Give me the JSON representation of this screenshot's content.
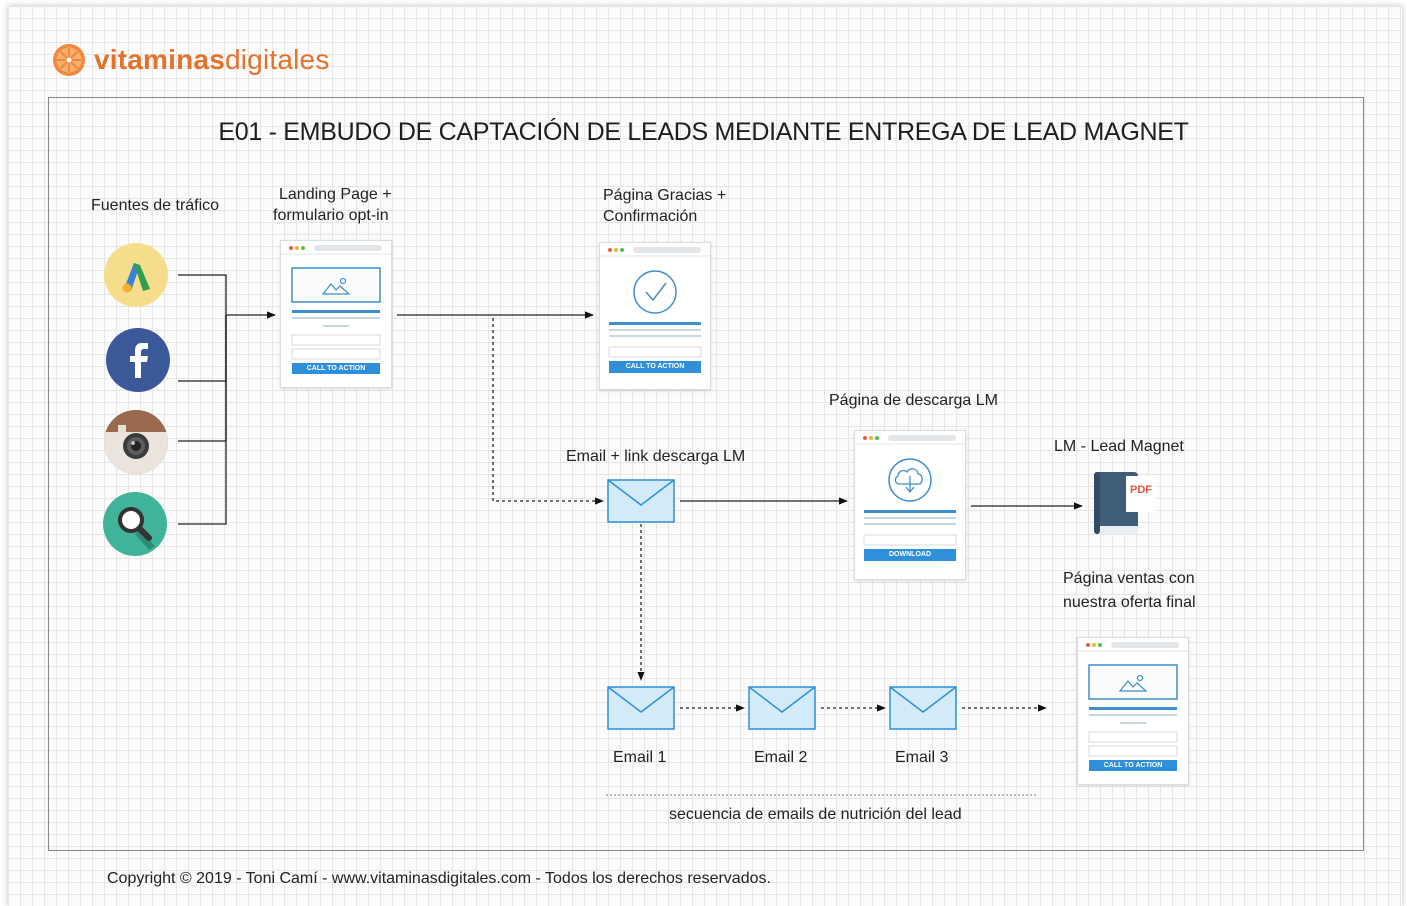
{
  "brand": {
    "name_bold": "vitaminas",
    "name_light": "digitales",
    "accent": "#e5712b"
  },
  "title": "E01 - EMBUDO DE CAPTACIÓN DE LEADS MEDIANTE ENTREGA DE LEAD MAGNET",
  "labels": {
    "traffic": "Fuentes de tráfico",
    "landing_1": "Landing Page +",
    "landing_2": "formulario opt-in",
    "thanks_1": "Página Gracias  +",
    "thanks_2": "Confirmación",
    "download_page": "Página de descarga LM",
    "email_link": "Email + link descarga LM",
    "lead_magnet": "LM - Lead Magnet",
    "sales_1": "Página ventas con",
    "sales_2": "nuestra oferta final",
    "email1": "Email 1",
    "email2": "Email 2",
    "email3": "Email 3",
    "sequence": "secuencia de emails de nutrición del lead"
  },
  "buttons": {
    "landing_cta": "CALL TO ACTION",
    "thanks_cta": "CALL TO ACTION",
    "download_cta": "DOWNLOAD",
    "sales_cta": "CALL TO ACTION"
  },
  "pdf_label": "PDF",
  "traffic_sources": [
    {
      "name": "adwords-icon",
      "color": "#f6dd8c"
    },
    {
      "name": "facebook-icon",
      "color": "#3b5998"
    },
    {
      "name": "instagram-icon",
      "color": "#a38573"
    },
    {
      "name": "search-icon",
      "color": "#3fb49a"
    }
  ],
  "colors": {
    "cta": "#2f8fd8",
    "email_fill": "#d3ebf9",
    "email_stroke": "#2f8fd8"
  },
  "footer": "Copyright © 2019  - Toni Camí - www.vitaminasdigitales.com - Todos los derechos reservados."
}
